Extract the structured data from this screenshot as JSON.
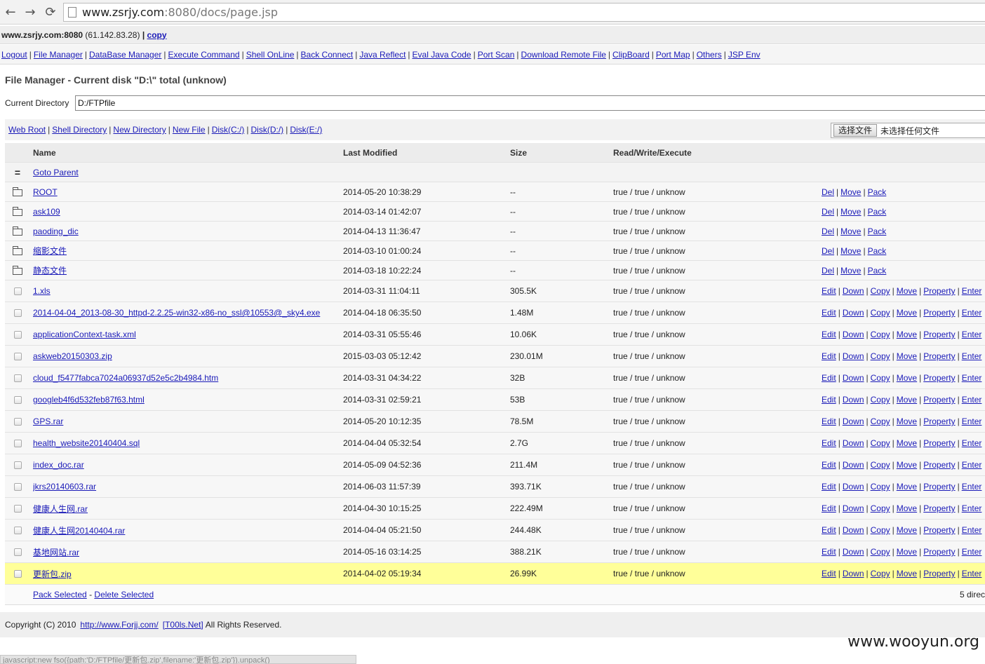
{
  "browser": {
    "back_glyph": "←",
    "forward_glyph": "→",
    "reload_glyph": "⟳",
    "url_host": "www.zsrjy.com",
    "url_rest": ":8080/docs/page.jsp"
  },
  "host": {
    "name": "www.zsrjy.com:8080",
    "ip": "(61.142.83.28)",
    "separator": "|",
    "copy_label": "copy"
  },
  "menu": [
    "Logout",
    "File Manager",
    "DataBase Manager",
    "Execute Command",
    "Shell OnLine",
    "Back Connect",
    "Java Reflect",
    "Eval Java Code",
    "Port Scan",
    "Download Remote File",
    "ClipBoard",
    "Port Map",
    "Others",
    "JSP Env"
  ],
  "page_heading": "File Manager - Current disk \"D:\\\" total (unknow)",
  "current_directory": {
    "label": "Current Directory",
    "value": "D:/FTPfile"
  },
  "quick_links": [
    "Web Root",
    "Shell Directory",
    "New Directory",
    "New File",
    "Disk(C:/)",
    "Disk(D:/)",
    "Disk(E:/)"
  ],
  "upload": {
    "button_label": "选择文件",
    "status": "未选择任何文件"
  },
  "table": {
    "headers": {
      "name": "Name",
      "modified": "Last Modified",
      "size": "Size",
      "rwx": "Read/Write/Execute"
    },
    "parent": {
      "icon": "=",
      "label": "Goto Parent"
    },
    "dirs": [
      {
        "name": "ROOT",
        "modified": "2014-05-20 10:38:29",
        "size": "--",
        "rwx": "true / true / unknow"
      },
      {
        "name": "ask109",
        "modified": "2014-03-14 01:42:07",
        "size": "--",
        "rwx": "true / true / unknow"
      },
      {
        "name": "paoding_dic",
        "modified": "2014-04-13 11:36:47",
        "size": "--",
        "rwx": "true / true / unknow"
      },
      {
        "name": "缩影文件",
        "modified": "2014-03-10 01:00:24",
        "size": "--",
        "rwx": "true / true / unknow"
      },
      {
        "name": "静态文件",
        "modified": "2014-03-18 10:22:24",
        "size": "--",
        "rwx": "true / true / unknow"
      }
    ],
    "dir_actions": [
      "Del",
      "Move",
      "Pack"
    ],
    "files": [
      {
        "name": "1.xls",
        "modified": "2014-03-31 11:04:11",
        "size": "305.5K",
        "rwx": "true / true / unknow"
      },
      {
        "name": "2014-04-04_2013-08-30_httpd-2.2.25-win32-x86-no_ssl@10553@_sky4.exe",
        "modified": "2014-04-18 06:35:50",
        "size": "1.48M",
        "rwx": "true / true / unknow"
      },
      {
        "name": "applicationContext-task.xml",
        "modified": "2014-03-31 05:55:46",
        "size": "10.06K",
        "rwx": "true / true / unknow"
      },
      {
        "name": "askweb20150303.zip",
        "modified": "2015-03-03 05:12:42",
        "size": "230.01M",
        "rwx": "true / true / unknow"
      },
      {
        "name": "cloud_f5477fabca7024a06937d52e5c2b4984.htm",
        "modified": "2014-03-31 04:34:22",
        "size": "32B",
        "rwx": "true / true / unknow"
      },
      {
        "name": "googleb4f6d532feb87f63.html",
        "modified": "2014-03-31 02:59:21",
        "size": "53B",
        "rwx": "true / true / unknow"
      },
      {
        "name": "GPS.rar",
        "modified": "2014-05-20 10:12:35",
        "size": "78.5M",
        "rwx": "true / true / unknow"
      },
      {
        "name": "health_website20140404.sql",
        "modified": "2014-04-04 05:32:54",
        "size": "2.7G",
        "rwx": "true / true / unknow"
      },
      {
        "name": "index_doc.rar",
        "modified": "2014-05-09 04:52:36",
        "size": "211.4M",
        "rwx": "true / true / unknow"
      },
      {
        "name": "jkrs20140603.rar",
        "modified": "2014-06-03 11:57:39",
        "size": "393.71K",
        "rwx": "true / true / unknow"
      },
      {
        "name": "健康人生网.rar",
        "modified": "2014-04-30 10:15:25",
        "size": "222.49M",
        "rwx": "true / true / unknow"
      },
      {
        "name": "健康人生网20140404.rar",
        "modified": "2014-04-04 05:21:50",
        "size": "244.48K",
        "rwx": "true / true / unknow"
      },
      {
        "name": "基地网站.rar",
        "modified": "2014-05-16 03:14:25",
        "size": "388.21K",
        "rwx": "true / true / unknow"
      },
      {
        "name": "更新包.zip",
        "modified": "2014-04-02 05:19:34",
        "size": "26.99K",
        "rwx": "true / true / unknow",
        "highlighted": true
      }
    ],
    "file_actions": [
      "Edit",
      "Down",
      "Copy",
      "Move",
      "Property",
      "Enter"
    ],
    "footer": {
      "pack_selected": "Pack Selected",
      "dash": "-",
      "delete_selected": "Delete Selected",
      "summary": "5 direc"
    }
  },
  "page_footer": {
    "copyright": "Copyright (C) 2010",
    "site_link": "http://www.Forjj.com/",
    "team_link": "[T00ls.Net]",
    "rights": "All Rights Reserved."
  },
  "watermark": "www.wooyun.org",
  "status_bar": "javascript:new fso({path:'D:/FTPfile/更新包.zip',filename:'更新包.zip'}).unpack()"
}
